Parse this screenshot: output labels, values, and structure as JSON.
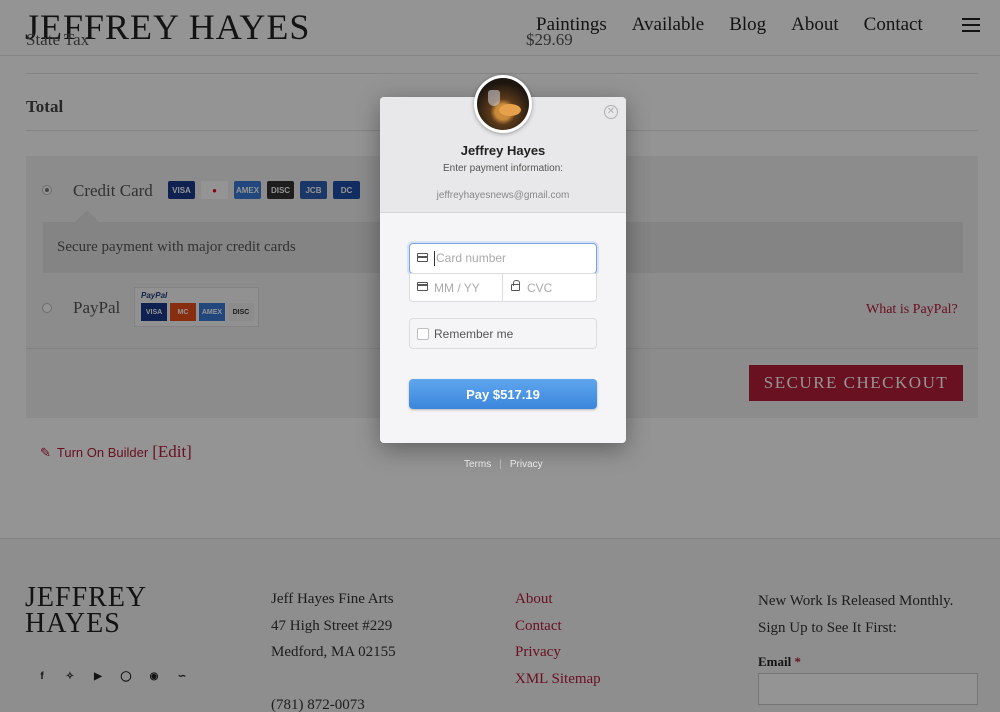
{
  "header": {
    "logo": "JEFFREY HAYES",
    "nav": [
      "Paintings",
      "Available",
      "Blog",
      "About",
      "Contact"
    ]
  },
  "order": {
    "state_tax_label": "State Tax",
    "state_tax_value": "$29.69",
    "total_label": "Total"
  },
  "payment": {
    "credit_card_label": "Credit Card",
    "card_brands": [
      "VISA",
      "MC",
      "AMEX",
      "DISC",
      "JCB",
      "DC"
    ],
    "credit_card_desc": "Secure payment with major credit cards",
    "paypal_label": "PayPal",
    "paypal_brand": "PayPal",
    "paypal_cards": [
      "VISA",
      "MC",
      "AMEX",
      "DISC"
    ],
    "what_is_paypal": "What is PayPal?",
    "checkout_button": "SECURE CHECKOUT"
  },
  "builder": {
    "link": "Turn On Builder",
    "edit": "[Edit]"
  },
  "modal": {
    "name": "Jeffrey Hayes",
    "subtitle": "Enter payment information:",
    "email": "jeffreyhayesnews@gmail.com",
    "card_placeholder": "Card number",
    "expiry_placeholder": "MM / YY",
    "cvc_placeholder": "CVC",
    "remember_label": "Remember me",
    "pay_button": "Pay $517.19",
    "terms": "Terms",
    "privacy": "Privacy"
  },
  "footer": {
    "logo_line1": "JEFFREY",
    "logo_line2": "HAYES",
    "address": [
      "Jeff Hayes Fine Arts",
      "47 High Street #229",
      "Medford, MA 02155",
      "",
      "(781) 872-0073"
    ],
    "links": [
      "About",
      "Contact",
      "Privacy",
      "XML Sitemap"
    ],
    "newsletter": [
      "New Work Is Released Monthly.",
      "Sign Up to See It First:"
    ],
    "email_label": "Email",
    "required_mark": "*",
    "socials": [
      "f",
      "t",
      "yt",
      "ig",
      "p",
      "rss"
    ]
  },
  "colors": {
    "accent": "#b61c3a",
    "pay_button": "#4a94e4"
  }
}
